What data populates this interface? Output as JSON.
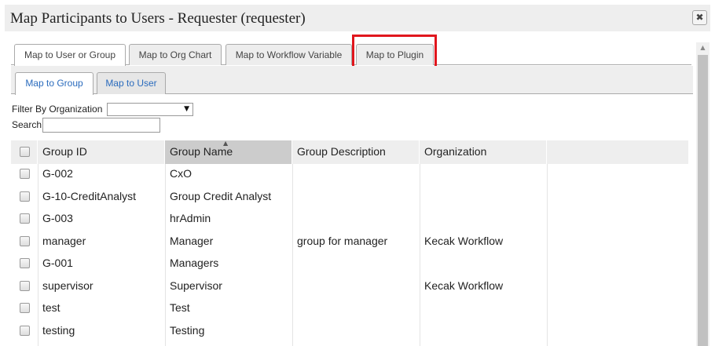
{
  "dialog": {
    "title": "Map Participants to Users - Requester (requester)",
    "close_symbol": "✖"
  },
  "outer_tabs": [
    {
      "label": "Map to User or Group",
      "active": true
    },
    {
      "label": "Map to Org Chart",
      "active": false
    },
    {
      "label": "Map to Workflow Variable",
      "active": false
    },
    {
      "label": "Map to Plugin",
      "active": false,
      "highlighted": true
    }
  ],
  "inner_tabs": [
    {
      "label": "Map to Group",
      "active": true
    },
    {
      "label": "Map to User",
      "active": false
    }
  ],
  "filter": {
    "org_label": "Filter By Organization",
    "org_value": "",
    "search_label": "Search",
    "search_value": ""
  },
  "table": {
    "columns": [
      "Group ID",
      "Group Name",
      "Group Description",
      "Organization"
    ],
    "sorted_column": "Group Name",
    "rows": [
      {
        "id": "G-002",
        "name": "CxO",
        "description": "",
        "organization": ""
      },
      {
        "id": "G-10-CreditAnalyst",
        "name": "Group Credit Analyst",
        "description": "",
        "organization": ""
      },
      {
        "id": "G-003",
        "name": "hrAdmin",
        "description": "",
        "organization": ""
      },
      {
        "id": "manager",
        "name": "Manager",
        "description": "group for manager",
        "organization": "Kecak Workflow"
      },
      {
        "id": "G-001",
        "name": "Managers",
        "description": "",
        "organization": ""
      },
      {
        "id": "supervisor",
        "name": "Supervisor",
        "description": "",
        "organization": "Kecak Workflow"
      },
      {
        "id": "test",
        "name": "Test",
        "description": "",
        "organization": ""
      },
      {
        "id": "testing",
        "name": "Testing",
        "description": "",
        "organization": ""
      }
    ]
  },
  "colors": {
    "highlight": "#e0161d",
    "link_blue": "#2a6bbd",
    "header_bg": "#eeeeee",
    "sorted_header_bg": "#cccccc"
  }
}
